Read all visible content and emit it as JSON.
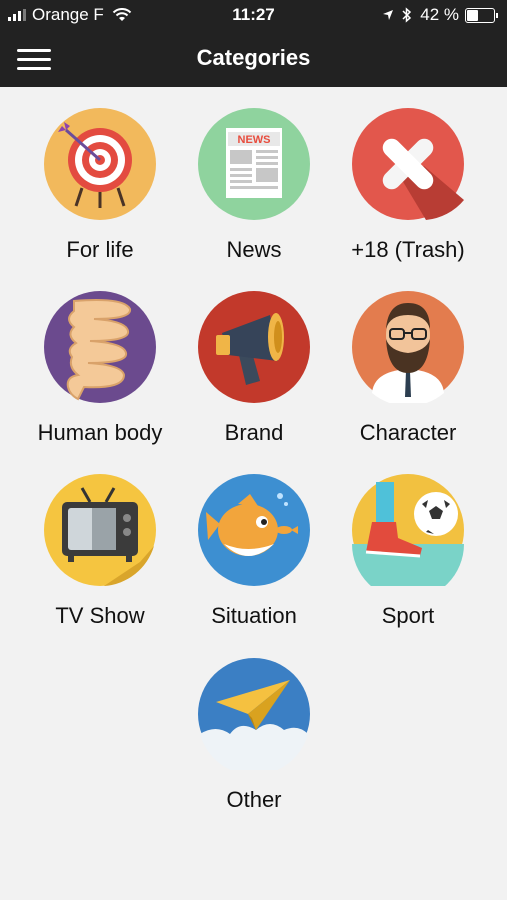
{
  "status": {
    "carrier": "Orange F",
    "time": "11:27",
    "battery": "42 %"
  },
  "header": {
    "title": "Categories"
  },
  "categories": [
    {
      "label": "For life",
      "icon": "target-icon"
    },
    {
      "label": "News",
      "icon": "newspaper-icon"
    },
    {
      "label": "+18 (Trash)",
      "icon": "cross-icon"
    },
    {
      "label": "Human body",
      "icon": "intestine-icon"
    },
    {
      "label": "Brand",
      "icon": "megaphone-icon"
    },
    {
      "label": "Character",
      "icon": "bearded-man-icon"
    },
    {
      "label": "TV Show",
      "icon": "television-icon"
    },
    {
      "label": "Situation",
      "icon": "fish-icon"
    },
    {
      "label": "Sport",
      "icon": "soccer-icon"
    },
    {
      "label": "Other",
      "icon": "paper-plane-icon"
    }
  ],
  "colors": {
    "bar": "#222222",
    "background": "#f2f2f2"
  }
}
